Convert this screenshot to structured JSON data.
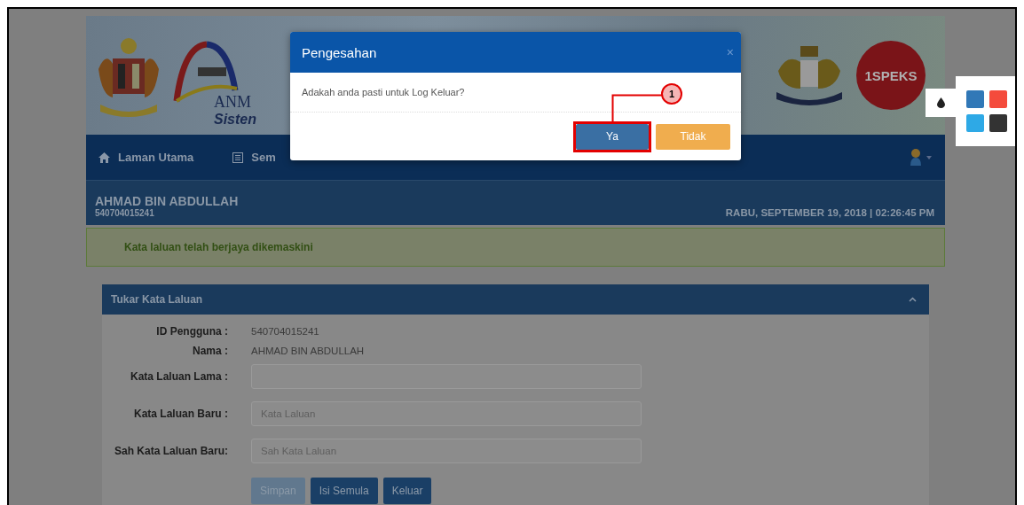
{
  "banner": {
    "logo_text": "ANM",
    "system_text": "Sisten",
    "badge_text": "1SPEKS"
  },
  "nav": {
    "items": [
      {
        "kind": "home",
        "label": "Laman Utama"
      },
      {
        "kind": "list",
        "label": "Sem"
      }
    ]
  },
  "user": {
    "name": "AHMAD BIN ABDULLAH",
    "id": "540704015241",
    "datetime": "RABU, SEPTEMBER 19, 2018 | 02:26:45 PM"
  },
  "alert": {
    "text": "Kata laluan telah berjaya dikemaskini"
  },
  "panel": {
    "title": "Tukar Kata Laluan",
    "fields": [
      {
        "kind": "text",
        "label": "ID Pengguna :",
        "value": "540704015241"
      },
      {
        "kind": "text",
        "label": "Nama :",
        "value": "AHMAD BIN ABDULLAH"
      },
      {
        "kind": "input",
        "label": "Kata Laluan Lama :"
      },
      {
        "kind": "input",
        "label": "Kata Laluan Baru :",
        "placeholder": "Kata Laluan"
      },
      {
        "kind": "input",
        "label": "Sah Kata Laluan Baru:",
        "placeholder": "Sah Kata Laluan"
      }
    ],
    "buttons": [
      {
        "label": "Simpan",
        "disabled": true
      },
      {
        "label": "Isi Semula",
        "disabled": false
      },
      {
        "label": "Keluar",
        "disabled": false
      }
    ]
  },
  "dialog": {
    "title": "Pengesahan",
    "close": "×",
    "message": "Adakah anda pasti untuk Log Keluar?",
    "buttons": [
      {
        "kind": "primary",
        "label": "Ya",
        "highlighted": true
      },
      {
        "kind": "warning",
        "label": "Tidak",
        "highlighted": false
      }
    ]
  },
  "callout": {
    "number": "1"
  },
  "palette": {
    "swatches": [
      {
        "color": "#3178b7"
      },
      {
        "color": "#f44b3c"
      },
      {
        "color": "#2ea9e6"
      },
      {
        "color": "#333333"
      }
    ]
  }
}
